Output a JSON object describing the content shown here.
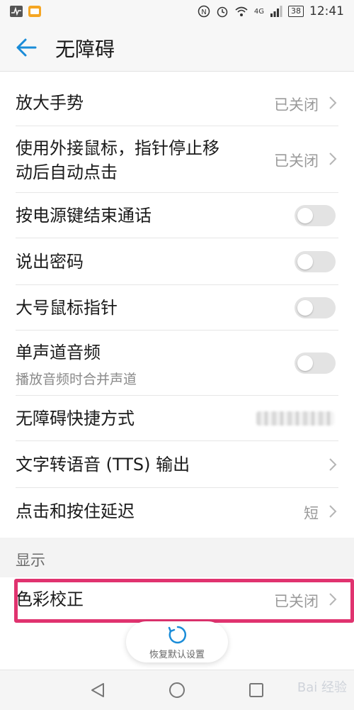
{
  "status_bar": {
    "time": "12:41",
    "battery": "38",
    "network": "4G"
  },
  "header": {
    "title": "无障碍"
  },
  "rows": [
    {
      "label": "放大手势",
      "value": "已关闭",
      "kind": "link"
    },
    {
      "label_line1": "使用外接鼠标，指针停止移",
      "label_line2": "动后自动点击",
      "value": "已关闭",
      "kind": "link"
    },
    {
      "label": "按电源键结束通话",
      "kind": "toggle",
      "on": false
    },
    {
      "label": "说出密码",
      "kind": "toggle",
      "on": false
    },
    {
      "label": "大号鼠标指针",
      "kind": "toggle",
      "on": false
    },
    {
      "label": "单声道音频",
      "subtitle": "播放音频时合并声道",
      "kind": "toggle",
      "on": false
    },
    {
      "label": "无障碍快捷方式",
      "kind": "blurred"
    },
    {
      "label": "文字转语音 (TTS) 输出",
      "kind": "link"
    },
    {
      "label": "点击和按住延迟",
      "value": "短",
      "kind": "link"
    }
  ],
  "section": {
    "label": "显示"
  },
  "highlighted_row": {
    "label": "色彩校正",
    "value": "已关闭"
  },
  "restore_button": {
    "label": "恢复默认设置"
  },
  "watermark": "Bai 经验",
  "colors": {
    "accent": "#1a8cd8",
    "highlight": "#e0336f",
    "toggle_off": "#e3e3e3"
  }
}
